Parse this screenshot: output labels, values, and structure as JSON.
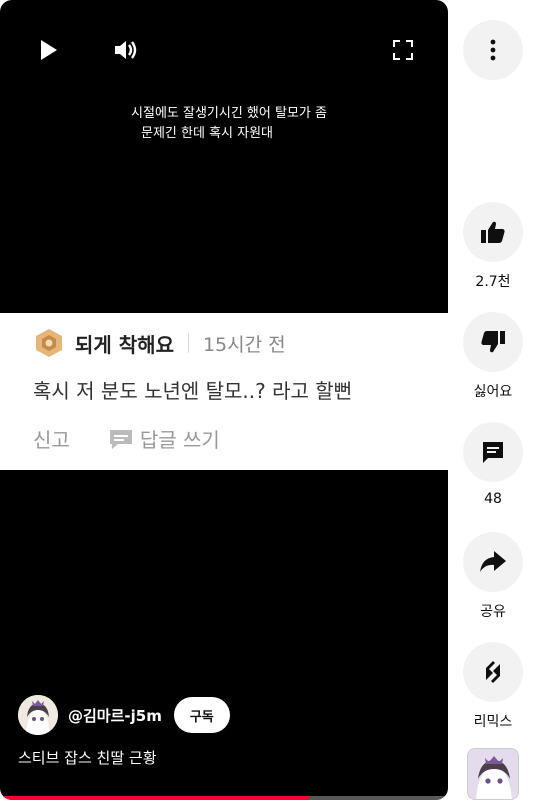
{
  "caption": {
    "line1": "시절에도 잘생기시긴 했어 탈모가 좀",
    "line2": "문제긴 한데 혹시 자원대"
  },
  "comment": {
    "author": "되게 착해요",
    "time": "15시간 전",
    "text": "혹시 저 분도 노년엔 탈모..? 라고 할뻔",
    "report": "신고",
    "reply": "답글 쓰기",
    "badge_color": "#c9a06a"
  },
  "channel": {
    "handle": "@김마르-j5m",
    "subscribe": "구독"
  },
  "video": {
    "title": "스티브 잡스 친딸 근황",
    "progress_fraction": 0.69,
    "progress_color": "#ff0033"
  },
  "actions": {
    "like_count": "2.7천",
    "dislike_label": "싫어요",
    "comment_count": "48",
    "share_label": "공유",
    "remix_label": "리믹스"
  }
}
